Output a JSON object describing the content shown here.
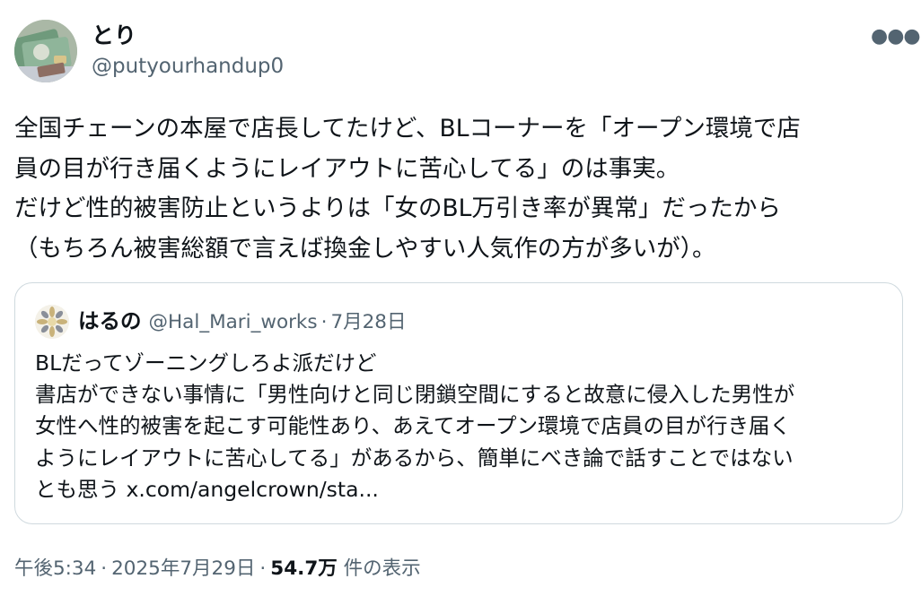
{
  "tweet": {
    "author": {
      "display_name": "とり",
      "handle": "@putyourhandup0"
    },
    "more_icon": "more-horizontal-icon",
    "text_lines": [
      "全国チェーンの本屋で店長してたけど、BLコーナーを「オープン環境で店",
      "員の目が行き届くようにレイアウトに苦心してる」のは事実。",
      "だけど性的被害防止というよりは「女のBL万引き率が異常」だったから",
      "（もちろん被害総額で言えば換金しやすい人気作の方が多いが）。"
    ],
    "quote": {
      "display_name": "はるの",
      "handle": "@Hal_Mari_works",
      "separator": "·",
      "date": "7月28日",
      "text_lines": [
        "BLだってゾーニングしろよ派だけど",
        "書店ができない事情に「男性向けと同じ閉鎖空間にすると故意に侵入した男性が",
        "女性へ性的被害を起こす可能性あり、あえてオープン環境で店員の目が行き届く",
        "ようにレイアウトに苦心してる」があるから、簡単にべき論で話すことではない",
        "とも思う x.com/angelcrown/sta..."
      ]
    },
    "footer": {
      "time": "午後5:34",
      "separator": "·",
      "date": "2025年7月29日",
      "views_count": "54.7万",
      "views_label": "件の表示"
    }
  },
  "colors": {
    "text_primary": "#0f1419",
    "text_secondary": "#536471",
    "border": "#cfd9de",
    "background": "#ffffff"
  }
}
